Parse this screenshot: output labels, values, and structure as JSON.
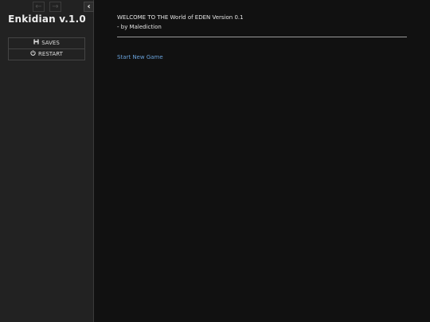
{
  "sidebar": {
    "back_icon": "←",
    "forward_icon": "→",
    "stow_icon": "‹",
    "title": "Enkidian v.1.0",
    "menu": {
      "saves_label": "SAVES",
      "saves_icon": "💾",
      "restart_label": "RESTART",
      "restart_icon": "⏻"
    }
  },
  "passage": {
    "line1": "WELCOME TO THE World of EDEN Version 0.1",
    "line2": "- by Malediction",
    "start_link": "Start New Game"
  },
  "colors": {
    "background": "#111111",
    "sidebar": "#222222",
    "link": "#68a0d8",
    "text": "#e5e5e5"
  }
}
